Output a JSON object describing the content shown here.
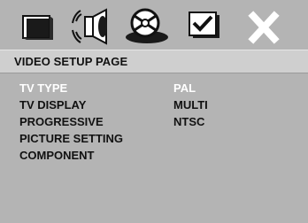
{
  "tabs": [
    {
      "icon": "monitor-icon"
    },
    {
      "icon": "speaker-icon"
    },
    {
      "icon": "video-disc-icon"
    },
    {
      "icon": "preference-check-icon"
    },
    {
      "icon": "close-x-icon"
    }
  ],
  "header": {
    "title": "VIDEO SETUP PAGE"
  },
  "menu": {
    "items": [
      {
        "label": "TV TYPE",
        "active": true
      },
      {
        "label": "TV DISPLAY"
      },
      {
        "label": "PROGRESSIVE"
      },
      {
        "label": "PICTURE SETTING"
      },
      {
        "label": "COMPONENT"
      }
    ]
  },
  "options": {
    "items": [
      {
        "label": "PAL",
        "active": true
      },
      {
        "label": "MULTI"
      },
      {
        "label": "NTSC"
      }
    ]
  },
  "colors": {
    "background": "#b4b4b4",
    "header_bar": "#cfcfcf",
    "highlight_text": "#ffffff",
    "normal_text": "#111111"
  }
}
